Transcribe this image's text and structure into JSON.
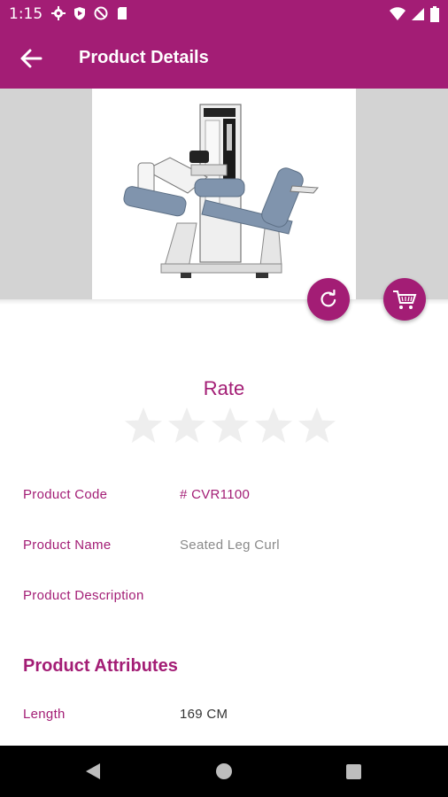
{
  "status_bar": {
    "time": "1:15"
  },
  "app_bar": {
    "title": "Product Details"
  },
  "rating": {
    "label": "Rate",
    "stars_total": 5,
    "stars_filled": 0
  },
  "details": {
    "code_label": "Product Code",
    "code_value": "# CVR1100",
    "name_label": "Product Name",
    "name_value": "Seated Leg Curl",
    "description_label": "Product Description"
  },
  "attributes": {
    "heading": "Product Attributes",
    "length_label": "Length",
    "length_value": "169 CM"
  },
  "colors": {
    "accent": "#a31d75",
    "hero_bg": "#d3d3d3",
    "star_empty": "#eeeeee"
  },
  "icons": [
    "settings-icon",
    "shield-icon",
    "no-sim-icon",
    "sd-card-icon",
    "wifi-icon",
    "signal-icon",
    "battery-icon",
    "back-arrow-icon",
    "refresh-icon",
    "cart-icon",
    "star-icon",
    "nav-back-icon",
    "nav-home-icon",
    "nav-recents-icon"
  ]
}
